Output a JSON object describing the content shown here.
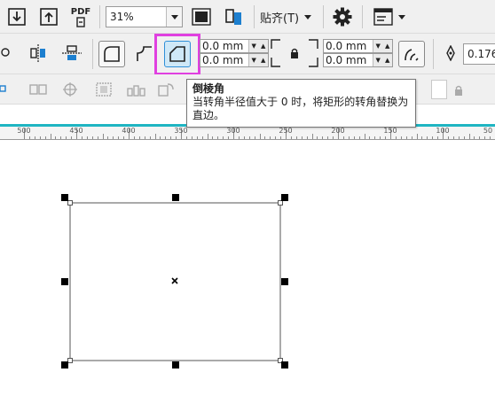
{
  "toolbar_top": {
    "export_pdf_label": "PDF",
    "zoom_value": "31%",
    "snap_label": "贴齐(T)",
    "icons": [
      "import-icon",
      "export-icon",
      "pdf-icon",
      "full-page-icon",
      "arrange-icon",
      "gear-icon",
      "window-icon"
    ]
  },
  "property_bar": {
    "corner_size_top": "0.0 mm",
    "corner_size_bottom": "0.0 mm",
    "corner_size_right_top": "0.0 mm",
    "corner_size_right_bottom": "0.0 mm",
    "outline_width": "0.176"
  },
  "tooltip": {
    "title": "倒棱角",
    "description": "当转角半径值大于 0 时，将矩形的转角替换为直边。"
  },
  "ruler": {
    "labels": [
      "500",
      "450",
      "400",
      "350",
      "300",
      "250",
      "200",
      "150",
      "100",
      "50"
    ]
  },
  "colors": {
    "highlight": "#e040e0",
    "ruler_accent": "#1fb5c2",
    "selected_button": "#cfe8f7"
  }
}
